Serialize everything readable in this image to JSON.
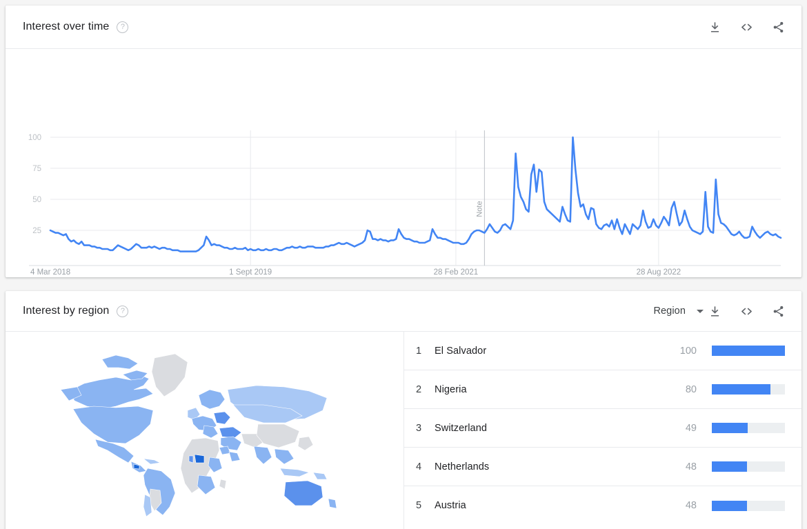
{
  "colors": {
    "line": "#4285f4",
    "bar": "#4285f4",
    "bar_track": "#eceff1",
    "card_bg": "#ffffff",
    "page_bg": "#f5f5f5",
    "map_none": "#dadce0"
  },
  "interest_over_time": {
    "title": "Interest over time",
    "help_icon": "help-circle-icon",
    "actions": [
      {
        "name": "download-icon",
        "label": "Download"
      },
      {
        "name": "embed-code-icon",
        "label": "Embed"
      },
      {
        "name": "share-icon",
        "label": "Share"
      }
    ]
  },
  "interest_by_region": {
    "title": "Interest by region",
    "help_icon": "help-circle-icon",
    "selector": {
      "label": "Region",
      "caret_icon": "chevron-down-icon"
    },
    "actions": [
      {
        "name": "download-icon",
        "label": "Download"
      },
      {
        "name": "embed-code-icon",
        "label": "Embed"
      },
      {
        "name": "share-icon",
        "label": "Share"
      }
    ],
    "rows": [
      {
        "rank": "1",
        "name": "El Salvador",
        "value": "100",
        "pct": 100
      },
      {
        "rank": "2",
        "name": "Nigeria",
        "value": "80",
        "pct": 80
      },
      {
        "rank": "3",
        "name": "Switzerland",
        "value": "49",
        "pct": 49
      },
      {
        "rank": "4",
        "name": "Netherlands",
        "value": "48",
        "pct": 48
      },
      {
        "rank": "5",
        "name": "Austria",
        "value": "48",
        "pct": 48
      }
    ]
  },
  "chart_data": {
    "type": "line",
    "title": "Interest over time",
    "xlabel": "",
    "ylabel": "",
    "ylim": [
      0,
      100
    ],
    "yticks": [
      25,
      50,
      75,
      100
    ],
    "ytick_labels": [
      "25",
      "50",
      "75",
      "100"
    ],
    "grid": true,
    "legend": "none",
    "xtick_labels": [
      "4 Mar 2018",
      "1 Sept 2019",
      "28 Feb 2021",
      "28 Aug 2022"
    ],
    "xtick_positions": [
      0,
      77,
      156,
      234
    ],
    "annotations": [
      {
        "label": "Note",
        "x_index": 167,
        "orientation": "vertical"
      }
    ],
    "x_count": 246,
    "values": [
      25,
      24,
      23,
      23,
      22,
      21,
      22,
      18,
      16,
      17,
      15,
      14,
      16,
      13,
      13,
      13,
      12,
      12,
      11,
      11,
      10,
      10,
      10,
      9,
      9,
      11,
      13,
      12,
      11,
      10,
      9,
      10,
      12,
      14,
      13,
      11,
      11,
      11,
      12,
      11,
      12,
      11,
      10,
      11,
      11,
      10,
      10,
      9,
      9,
      9,
      8,
      8,
      8,
      8,
      8,
      8,
      8,
      9,
      11,
      13,
      20,
      17,
      13,
      14,
      13,
      13,
      12,
      11,
      11,
      10,
      10,
      11,
      10,
      10,
      10,
      11,
      9,
      10,
      9,
      9,
      10,
      9,
      9,
      10,
      9,
      9,
      10,
      10,
      9,
      9,
      10,
      11,
      11,
      12,
      11,
      11,
      12,
      11,
      11,
      12,
      12,
      12,
      11,
      11,
      11,
      11,
      12,
      12,
      13,
      13,
      14,
      15,
      14,
      14,
      15,
      14,
      13,
      12,
      13,
      14,
      15,
      17,
      25,
      24,
      18,
      18,
      17,
      18,
      17,
      17,
      16,
      17,
      17,
      18,
      26,
      22,
      19,
      18,
      18,
      17,
      16,
      16,
      15,
      15,
      15,
      16,
      17,
      26,
      22,
      19,
      19,
      18,
      18,
      17,
      16,
      15,
      15,
      15,
      14,
      14,
      15,
      18,
      22,
      24,
      25,
      25,
      24,
      23,
      26,
      30,
      27,
      24,
      23,
      25,
      29,
      30,
      28,
      26,
      33,
      87,
      60,
      52,
      48,
      42,
      40,
      70,
      78,
      56,
      74,
      72,
      48,
      42,
      40,
      38,
      36,
      34,
      32,
      44,
      38,
      33,
      32,
      100,
      74,
      55,
      44,
      46,
      38,
      34,
      43,
      42,
      30,
      27,
      26,
      29,
      30,
      28,
      33,
      26,
      34,
      27,
      22,
      30,
      26,
      22,
      30,
      28,
      26,
      29,
      41,
      32,
      27,
      28,
      34,
      29,
      27,
      31,
      36,
      33,
      29,
      43,
      48,
      38,
      29,
      32,
      41,
      34,
      28,
      25,
      24,
      23,
      22,
      24,
      56,
      28,
      24,
      23,
      66,
      38,
      31,
      30,
      28,
      25,
      22,
      21,
      22,
      24,
      21,
      19,
      19,
      20,
      28,
      24,
      21,
      19,
      21,
      23,
      24,
      22,
      21,
      22,
      20,
      19
    ]
  }
}
